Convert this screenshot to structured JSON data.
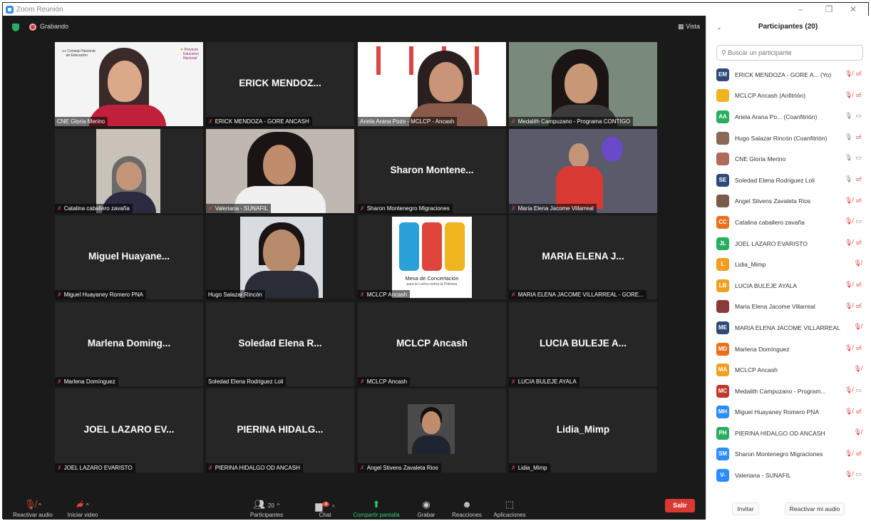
{
  "window": {
    "title": "Zoom Reunión"
  },
  "topbar": {
    "recording": "Grabando",
    "view": "Vista"
  },
  "tiles": [
    {
      "big": "",
      "caption": "CNE Gloria Merino",
      "muted": false
    },
    {
      "big": "ERICK MENDOZ...",
      "caption": "ERICK MENDOZA - GORE ANCASH",
      "muted": true
    },
    {
      "big": "",
      "caption": "Ariela Arana Pozo - MCLCP - Ancash",
      "muted": false
    },
    {
      "big": "",
      "caption": "Medalith Campuzano - Programa CONTIGO",
      "muted": true
    },
    {
      "big": "",
      "caption": "Catalina caballero zavaña",
      "muted": true
    },
    {
      "big": "",
      "caption": "Valeriana - SUNAFIL",
      "muted": true
    },
    {
      "big": "Sharon Montene...",
      "caption": "Sharon Montenegro Migraciones",
      "muted": true
    },
    {
      "big": "",
      "caption": "Maria Elena Jacome Villarreal",
      "muted": true
    },
    {
      "big": "Miguel Huayane...",
      "caption": "Miguel Huayaney Romero PNA",
      "muted": true
    },
    {
      "big": "",
      "caption": "Hugo Salazar Rincón",
      "muted": false
    },
    {
      "big": "",
      "caption": "MCLCP Ancash",
      "muted": true
    },
    {
      "big": "MARIA ELENA J...",
      "caption": "MARIA ELENA JACOME VILLARREAL - GORE...",
      "muted": true
    },
    {
      "big": "Marlena Doming...",
      "caption": "Marlena Domínguez",
      "muted": true
    },
    {
      "big": "Soledad Elena R...",
      "caption": "Soledad Elena Rodriguez Loli",
      "muted": false
    },
    {
      "big": "MCLCP Ancash",
      "caption": "MCLCP Ancash",
      "muted": true
    },
    {
      "big": "LUCIA BULEJE A...",
      "caption": "LUCIA BULEJE AYALA",
      "muted": true
    },
    {
      "big": "JOEL LAZARO EV...",
      "caption": "JOEL LAZARO EVARISTO",
      "muted": true
    },
    {
      "big": "PIERINA HIDALG...",
      "caption": "PIERINA HIDALGO OD ANCASH",
      "muted": true
    },
    {
      "big": "",
      "caption": "Angel Stivens Zavaleta Rios",
      "muted": true
    },
    {
      "big": "Lidia_Mimp",
      "caption": "Lidia_Mimp",
      "muted": true
    }
  ],
  "logos": {
    "cne_line1": "Consejo Nacional",
    "cne_line2": "de Educación",
    "pen_line1": "Proyecto",
    "pen_line2": "Educativo",
    "pen_line3": "Nacional",
    "mesa_line1": "Mesa de Concertación",
    "mesa_line2": "para la Lucha contra la Pobreza"
  },
  "toolbar": {
    "audio": "Reactivar audio",
    "video": "Iniciar video",
    "participants": "Participantes",
    "participants_count": "20",
    "chat": "Chat",
    "chat_badge": "4",
    "share": "Compartir pantalla",
    "record": "Grabar",
    "reactions": "Reacciones",
    "apps": "Aplicaciones",
    "leave": "Salir"
  },
  "panel": {
    "title": "Participantes (20)",
    "search_placeholder": "Buscar un participante",
    "invite": "Invitar",
    "unmute_me": "Reactivar mi audio",
    "participants": [
      {
        "initials": "EM",
        "color": "#2d4a7a",
        "name": "ERICK MENDOZA - GORE A... (Yo)",
        "mic": "muted",
        "video": "off"
      },
      {
        "initials": "",
        "color": "#f0b41e",
        "name": "MCLCP Ancash (Anfitrión)",
        "mic": "muted",
        "video": "off"
      },
      {
        "initials": "AA",
        "color": "#27ae60",
        "name": "Ariela Arana Po... (Coanfitrión)",
        "mic": "on",
        "video": "on"
      },
      {
        "initials": "",
        "color": "#8a6a55",
        "name": "Hugo Salazar Rincón (Coanfitrión)",
        "mic": "on",
        "video": "off"
      },
      {
        "initials": "",
        "color": "#b06a5a",
        "name": "CNE Gloria Merino",
        "mic": "on",
        "video": "on"
      },
      {
        "initials": "SE",
        "color": "#2d4a7a",
        "name": "Soledad Elena Rodriguez Loli",
        "mic": "on",
        "video": "off"
      },
      {
        "initials": "",
        "color": "#7a5a4a",
        "name": "Angel Stivens Zavaleta Rios",
        "mic": "muted",
        "video": "off"
      },
      {
        "initials": "CC",
        "color": "#e8711c",
        "name": "Catalina caballero zavaña",
        "mic": "muted",
        "video": "on"
      },
      {
        "initials": "JL",
        "color": "#27ae60",
        "name": "JOEL LAZARO EVARISTO",
        "mic": "muted",
        "video": "off"
      },
      {
        "initials": "L",
        "color": "#f0a020",
        "name": "Lidia_Mimp",
        "mic": "muted",
        "video": ""
      },
      {
        "initials": "LB",
        "color": "#f0a020",
        "name": "LUCIA BULEJE AYALA",
        "mic": "muted",
        "video": "off"
      },
      {
        "initials": "",
        "color": "#8a3a3a",
        "name": "Maria Elena Jacome Villarreal",
        "mic": "muted",
        "video": "off"
      },
      {
        "initials": "ME",
        "color": "#2d4a7a",
        "name": "MARIA ELENA JACOME VILLARREAL ...",
        "mic": "muted",
        "video": ""
      },
      {
        "initials": "MD",
        "color": "#e8711c",
        "name": "Marlena Domínguez",
        "mic": "muted",
        "video": "off"
      },
      {
        "initials": "MA",
        "color": "#f0a020",
        "name": "MCLCP Ancash",
        "mic": "muted",
        "video": ""
      },
      {
        "initials": "MC",
        "color": "#c0392b",
        "name": "Medalith Campuzano - Program...",
        "mic": "muted",
        "video": "on"
      },
      {
        "initials": "MH",
        "color": "#2d8cff",
        "name": "Miguel Huayaney Romero PNA",
        "mic": "muted",
        "video": "off"
      },
      {
        "initials": "PH",
        "color": "#27ae60",
        "name": "PIERINA HIDALGO OD ANCASH",
        "mic": "muted",
        "video": ""
      },
      {
        "initials": "SM",
        "color": "#2d8cff",
        "name": "Sharon Montenegro Migraciones",
        "mic": "muted",
        "video": "off"
      },
      {
        "initials": "V-",
        "color": "#2d8cff",
        "name": "Valeriana - SUNAFIL",
        "mic": "muted",
        "video": "on"
      }
    ]
  }
}
